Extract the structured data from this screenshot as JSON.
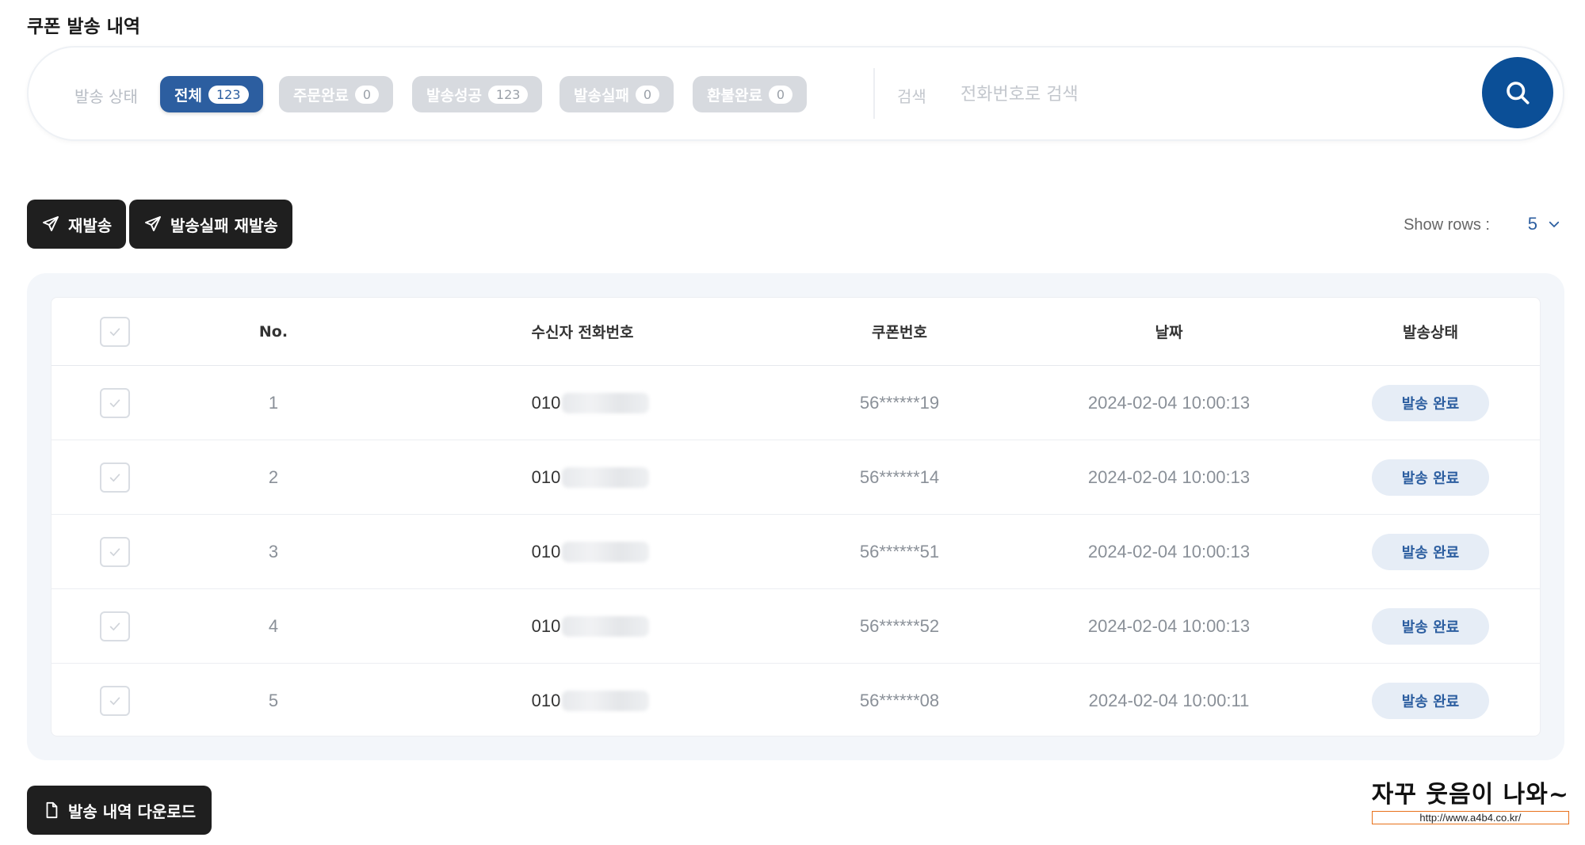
{
  "page_title": "쿠폰 발송 내역",
  "filter": {
    "status_label": "발송 상태",
    "chips": [
      {
        "label": "전체",
        "count": "123",
        "active": true
      },
      {
        "label": "주문완료",
        "count": "0",
        "active": false
      },
      {
        "label": "발송성공",
        "count": "123",
        "active": false
      },
      {
        "label": "발송실패",
        "count": "0",
        "active": false
      },
      {
        "label": "환불완료",
        "count": "0",
        "active": false
      }
    ],
    "search_label": "검색",
    "search_placeholder": "전화번호로 검색",
    "search_icon": "search-icon"
  },
  "actions": {
    "resend_label": "재발송",
    "resend_failed_label": "발송실패 재발송",
    "show_rows_label": "Show rows :",
    "rows_value": "5"
  },
  "table": {
    "headers": {
      "no": "No.",
      "phone": "수신자 전화번호",
      "coupon": "쿠폰번호",
      "date": "날짜",
      "status": "발송상태"
    },
    "rows": [
      {
        "no": "1",
        "phone": "010",
        "coupon": "56******19",
        "date": "2024-02-04 10:00:13",
        "status": "발송 완료"
      },
      {
        "no": "2",
        "phone": "010",
        "coupon": "56******14",
        "date": "2024-02-04 10:00:13",
        "status": "발송 완료"
      },
      {
        "no": "3",
        "phone": "010",
        "coupon": "56******51",
        "date": "2024-02-04 10:00:13",
        "status": "발송 완료"
      },
      {
        "no": "4",
        "phone": "010",
        "coupon": "56******52",
        "date": "2024-02-04 10:00:13",
        "status": "발송 완료"
      },
      {
        "no": "5",
        "phone": "010",
        "coupon": "56******08",
        "date": "2024-02-04 10:00:11",
        "status": "발송 완료"
      }
    ]
  },
  "download_label": "발송 내역 다운로드",
  "watermark": {
    "title": "자꾸 웃음이 나와~",
    "url": "http://www.a4b4.co.kr/"
  },
  "colors": {
    "accent": "#2c5ea0",
    "search_button": "#0b4f97",
    "dark_button": "#1f1f1f",
    "chip_inactive": "#d7dadf"
  }
}
